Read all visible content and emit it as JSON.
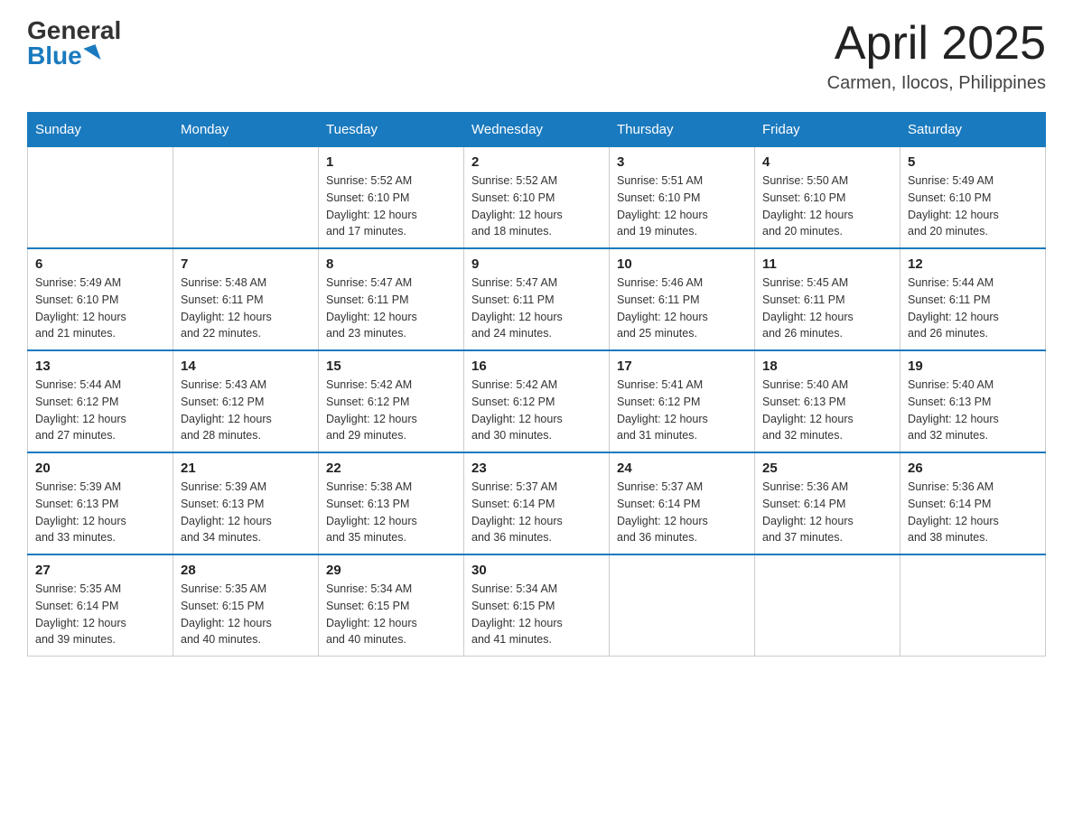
{
  "logo": {
    "general": "General",
    "blue": "Blue"
  },
  "title": "April 2025",
  "location": "Carmen, Ilocos, Philippines",
  "days_of_week": [
    "Sunday",
    "Monday",
    "Tuesday",
    "Wednesday",
    "Thursday",
    "Friday",
    "Saturday"
  ],
  "weeks": [
    [
      {
        "day": "",
        "info": ""
      },
      {
        "day": "",
        "info": ""
      },
      {
        "day": "1",
        "info": "Sunrise: 5:52 AM\nSunset: 6:10 PM\nDaylight: 12 hours\nand 17 minutes."
      },
      {
        "day": "2",
        "info": "Sunrise: 5:52 AM\nSunset: 6:10 PM\nDaylight: 12 hours\nand 18 minutes."
      },
      {
        "day": "3",
        "info": "Sunrise: 5:51 AM\nSunset: 6:10 PM\nDaylight: 12 hours\nand 19 minutes."
      },
      {
        "day": "4",
        "info": "Sunrise: 5:50 AM\nSunset: 6:10 PM\nDaylight: 12 hours\nand 20 minutes."
      },
      {
        "day": "5",
        "info": "Sunrise: 5:49 AM\nSunset: 6:10 PM\nDaylight: 12 hours\nand 20 minutes."
      }
    ],
    [
      {
        "day": "6",
        "info": "Sunrise: 5:49 AM\nSunset: 6:10 PM\nDaylight: 12 hours\nand 21 minutes."
      },
      {
        "day": "7",
        "info": "Sunrise: 5:48 AM\nSunset: 6:11 PM\nDaylight: 12 hours\nand 22 minutes."
      },
      {
        "day": "8",
        "info": "Sunrise: 5:47 AM\nSunset: 6:11 PM\nDaylight: 12 hours\nand 23 minutes."
      },
      {
        "day": "9",
        "info": "Sunrise: 5:47 AM\nSunset: 6:11 PM\nDaylight: 12 hours\nand 24 minutes."
      },
      {
        "day": "10",
        "info": "Sunrise: 5:46 AM\nSunset: 6:11 PM\nDaylight: 12 hours\nand 25 minutes."
      },
      {
        "day": "11",
        "info": "Sunrise: 5:45 AM\nSunset: 6:11 PM\nDaylight: 12 hours\nand 26 minutes."
      },
      {
        "day": "12",
        "info": "Sunrise: 5:44 AM\nSunset: 6:11 PM\nDaylight: 12 hours\nand 26 minutes."
      }
    ],
    [
      {
        "day": "13",
        "info": "Sunrise: 5:44 AM\nSunset: 6:12 PM\nDaylight: 12 hours\nand 27 minutes."
      },
      {
        "day": "14",
        "info": "Sunrise: 5:43 AM\nSunset: 6:12 PM\nDaylight: 12 hours\nand 28 minutes."
      },
      {
        "day": "15",
        "info": "Sunrise: 5:42 AM\nSunset: 6:12 PM\nDaylight: 12 hours\nand 29 minutes."
      },
      {
        "day": "16",
        "info": "Sunrise: 5:42 AM\nSunset: 6:12 PM\nDaylight: 12 hours\nand 30 minutes."
      },
      {
        "day": "17",
        "info": "Sunrise: 5:41 AM\nSunset: 6:12 PM\nDaylight: 12 hours\nand 31 minutes."
      },
      {
        "day": "18",
        "info": "Sunrise: 5:40 AM\nSunset: 6:13 PM\nDaylight: 12 hours\nand 32 minutes."
      },
      {
        "day": "19",
        "info": "Sunrise: 5:40 AM\nSunset: 6:13 PM\nDaylight: 12 hours\nand 32 minutes."
      }
    ],
    [
      {
        "day": "20",
        "info": "Sunrise: 5:39 AM\nSunset: 6:13 PM\nDaylight: 12 hours\nand 33 minutes."
      },
      {
        "day": "21",
        "info": "Sunrise: 5:39 AM\nSunset: 6:13 PM\nDaylight: 12 hours\nand 34 minutes."
      },
      {
        "day": "22",
        "info": "Sunrise: 5:38 AM\nSunset: 6:13 PM\nDaylight: 12 hours\nand 35 minutes."
      },
      {
        "day": "23",
        "info": "Sunrise: 5:37 AM\nSunset: 6:14 PM\nDaylight: 12 hours\nand 36 minutes."
      },
      {
        "day": "24",
        "info": "Sunrise: 5:37 AM\nSunset: 6:14 PM\nDaylight: 12 hours\nand 36 minutes."
      },
      {
        "day": "25",
        "info": "Sunrise: 5:36 AM\nSunset: 6:14 PM\nDaylight: 12 hours\nand 37 minutes."
      },
      {
        "day": "26",
        "info": "Sunrise: 5:36 AM\nSunset: 6:14 PM\nDaylight: 12 hours\nand 38 minutes."
      }
    ],
    [
      {
        "day": "27",
        "info": "Sunrise: 5:35 AM\nSunset: 6:14 PM\nDaylight: 12 hours\nand 39 minutes."
      },
      {
        "day": "28",
        "info": "Sunrise: 5:35 AM\nSunset: 6:15 PM\nDaylight: 12 hours\nand 40 minutes."
      },
      {
        "day": "29",
        "info": "Sunrise: 5:34 AM\nSunset: 6:15 PM\nDaylight: 12 hours\nand 40 minutes."
      },
      {
        "day": "30",
        "info": "Sunrise: 5:34 AM\nSunset: 6:15 PM\nDaylight: 12 hours\nand 41 minutes."
      },
      {
        "day": "",
        "info": ""
      },
      {
        "day": "",
        "info": ""
      },
      {
        "day": "",
        "info": ""
      }
    ]
  ]
}
